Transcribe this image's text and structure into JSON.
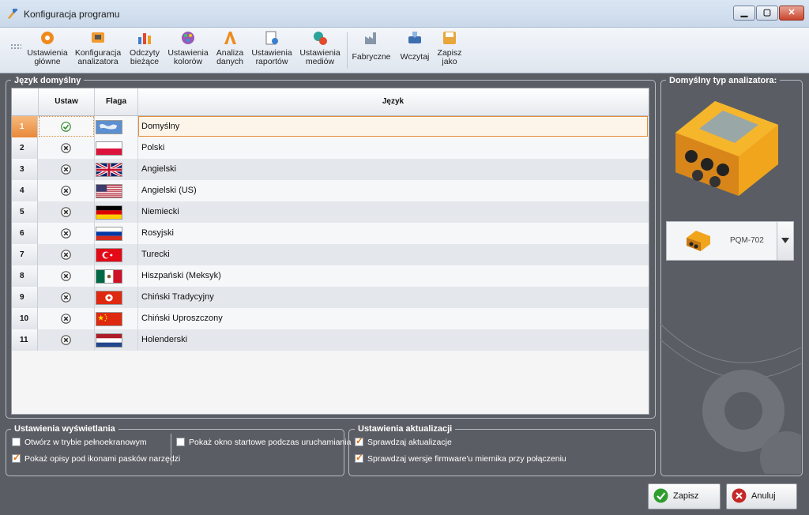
{
  "window": {
    "title": "Konfiguracja programu"
  },
  "toolbar": {
    "buttons": [
      {
        "label": "Ustawienia\ngłówne",
        "icon": "settings-gear-icon"
      },
      {
        "label": "Konfiguracja\nanalizatora",
        "icon": "analyzer-config-icon"
      },
      {
        "label": "Odczyty\nbieżące",
        "icon": "current-readings-icon"
      },
      {
        "label": "Ustawienia\nkolorów",
        "icon": "color-palette-icon"
      },
      {
        "label": "Analiza\ndanych",
        "icon": "data-analysis-icon"
      },
      {
        "label": "Ustawienia\nraportów",
        "icon": "report-settings-icon"
      },
      {
        "label": "Ustawienia\nmediów",
        "icon": "media-settings-icon"
      },
      {
        "label": "Fabryczne",
        "icon": "factory-reset-icon"
      },
      {
        "label": "Wczytaj",
        "icon": "load-icon"
      },
      {
        "label": "Zapisz\njako",
        "icon": "save-as-icon"
      }
    ]
  },
  "language_panel": {
    "title": "Język domyślny",
    "headers": {
      "ustaw": "Ustaw",
      "flaga": "Flaga",
      "jezyk": "Język"
    },
    "rows": [
      {
        "num": "1",
        "language": "Domyślny",
        "set": true,
        "flag": "world"
      },
      {
        "num": "2",
        "language": "Polski",
        "set": false,
        "flag": "pl"
      },
      {
        "num": "3",
        "language": "Angielski",
        "set": false,
        "flag": "uk"
      },
      {
        "num": "4",
        "language": "Angielski (US)",
        "set": false,
        "flag": "us"
      },
      {
        "num": "5",
        "language": "Niemiecki",
        "set": false,
        "flag": "de"
      },
      {
        "num": "6",
        "language": "Rosyjski",
        "set": false,
        "flag": "ru"
      },
      {
        "num": "7",
        "language": "Turecki",
        "set": false,
        "flag": "tr"
      },
      {
        "num": "8",
        "language": "Hiszpański (Meksyk)",
        "set": false,
        "flag": "mx"
      },
      {
        "num": "9",
        "language": "Chiński Tradycyjny",
        "set": false,
        "flag": "hk"
      },
      {
        "num": "10",
        "language": "Chiński Uproszczony",
        "set": false,
        "flag": "cn"
      },
      {
        "num": "11",
        "language": "Holenderski",
        "set": false,
        "flag": "nl"
      }
    ]
  },
  "analyzer_panel": {
    "title": "Domyślny typ analizatora:",
    "selected": "PQM-702"
  },
  "display_settings": {
    "title": "Ustawienia wyświetlania",
    "fullscreen": {
      "label": "Otwórz w trybie pełnoekranowym",
      "checked": false
    },
    "show_captions": {
      "label": "Pokaż opisy pod ikonami pasków narzędzi",
      "checked": true
    },
    "startup_window": {
      "label": "Pokaż okno startowe podczas uruchamiania",
      "checked": false
    }
  },
  "update_settings": {
    "title": "Ustawienia aktualizacji",
    "check_updates": {
      "label": "Sprawdzaj aktualizacje",
      "checked": true
    },
    "check_firmware": {
      "label": "Sprawdzaj wersje firmware'u miernika przy połączeniu",
      "checked": true
    }
  },
  "footer": {
    "save_label": "Zapisz",
    "cancel_label": "Anuluj"
  },
  "colors": {
    "accent": "#e8893a",
    "background": "#5a5e64",
    "ok": "#2e9d2e",
    "cancel": "#c62828"
  }
}
